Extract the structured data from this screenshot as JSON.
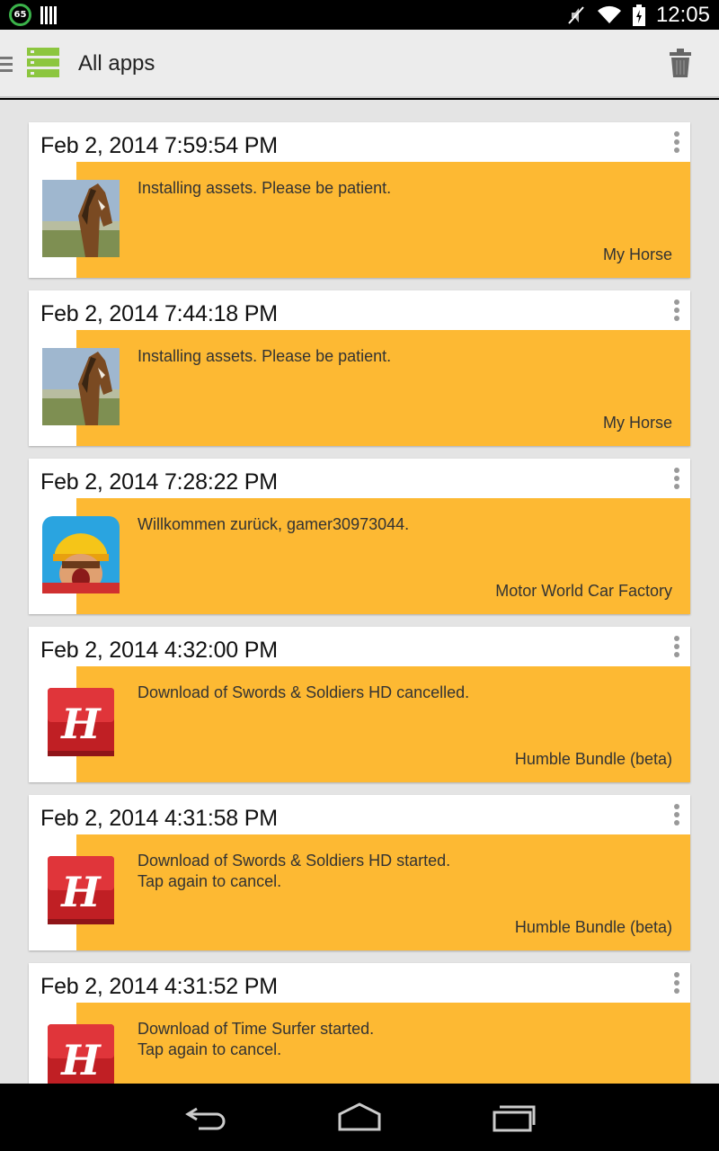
{
  "status_bar": {
    "badge": "65",
    "time": "12:05",
    "icons": [
      "notification-count-icon",
      "barcode-icon",
      "muted-icon",
      "wifi-icon",
      "battery-charging-icon"
    ]
  },
  "action_bar": {
    "title": "All apps",
    "icons": [
      "drawer-icon",
      "app-logo-icon",
      "trash-icon"
    ]
  },
  "notifications": [
    {
      "time": "Feb 2, 2014 7:59:54 PM",
      "message_lines": [
        "Installing assets. Please be patient.",
        ""
      ],
      "app": "My Horse",
      "icon": "horse"
    },
    {
      "time": "Feb 2, 2014 7:44:18 PM",
      "message_lines": [
        "Installing assets. Please be patient.",
        ""
      ],
      "app": "My Horse",
      "icon": "horse"
    },
    {
      "time": "Feb 2, 2014 7:28:22 PM",
      "message_lines": [
        "Willkommen zurück, gamer30973044.",
        ""
      ],
      "app": "Motor World Car Factory",
      "icon": "motorworld"
    },
    {
      "time": "Feb 2, 2014 4:32:00 PM",
      "message_lines": [
        "Download of Swords & Soldiers HD cancelled.",
        ""
      ],
      "app": "Humble Bundle (beta)",
      "icon": "humble"
    },
    {
      "time": "Feb 2, 2014 4:31:58 PM",
      "message_lines": [
        "Download of Swords & Soldiers HD started.",
        "Tap again to cancel."
      ],
      "app": "Humble Bundle (beta)",
      "icon": "humble"
    },
    {
      "time": "Feb 2, 2014 4:31:52 PM",
      "message_lines": [
        "Download of Time Surfer started.",
        "Tap again to cancel."
      ],
      "app": "",
      "icon": "humble"
    }
  ],
  "colors": {
    "card_accent": "#fdb933",
    "app_logo": "#8cc63f",
    "humble_red": "#d7262c"
  },
  "nav_bar": {
    "icons": [
      "back-icon",
      "home-icon",
      "recents-icon"
    ]
  }
}
